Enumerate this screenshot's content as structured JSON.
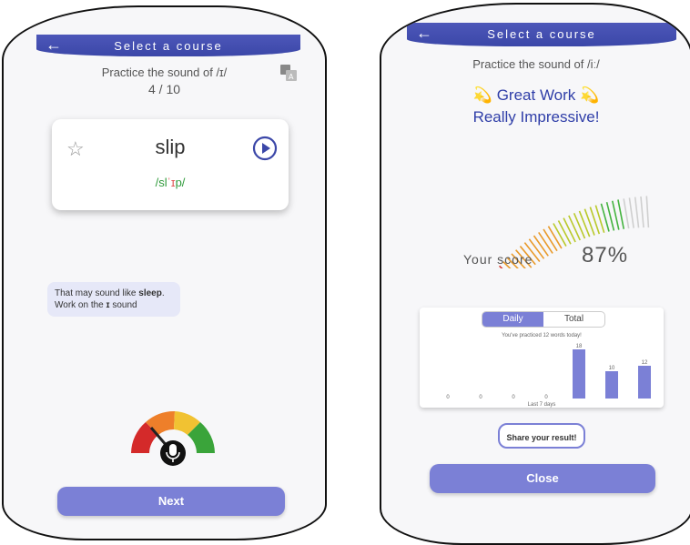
{
  "left": {
    "appbar": {
      "back_icon": "←",
      "title": "Select a course"
    },
    "practice_title": "Practice the sound of /ɪ/",
    "progress": "4 / 10",
    "translate_icon": "translate-icon",
    "card": {
      "star_icon": "☆",
      "word": "slip",
      "ipa_pre": "/sl",
      "ipa_mark": "ˈɪ",
      "ipa_post": "p/",
      "play_icon": "play-icon"
    },
    "feedback": {
      "prefix": "That may sound like ",
      "word": "sleep",
      "suffix": ".",
      "line2_prefix": "Work on the ",
      "sound": "ɪ",
      "line2_suffix": " sound"
    },
    "gauge": {
      "level": 0.33,
      "icon": "microphone-icon"
    },
    "next_label": "Next",
    "colors": {
      "accent": "#7b80d6",
      "appbar": "#3b47a8"
    }
  },
  "right": {
    "appbar": {
      "back_icon": "←",
      "title": "Select a course"
    },
    "practice_title": "Practice the sound of /iː/",
    "great_work": "💫 Great Work 💫",
    "impressive": "Really Impressive!",
    "score_label": "Your score",
    "score_value": "87%",
    "score": 0.87,
    "stats": {
      "tabs": [
        "Daily",
        "Total"
      ],
      "practiced_text": "You've practiced 12 words today!",
      "footer": "Last 7 days"
    },
    "share_label": "Share your result!",
    "close_label": "Close"
  },
  "chart_data": {
    "type": "bar",
    "values": [
      0,
      0,
      0,
      0,
      18,
      10,
      12
    ],
    "xlabel": "Last 7 days"
  }
}
